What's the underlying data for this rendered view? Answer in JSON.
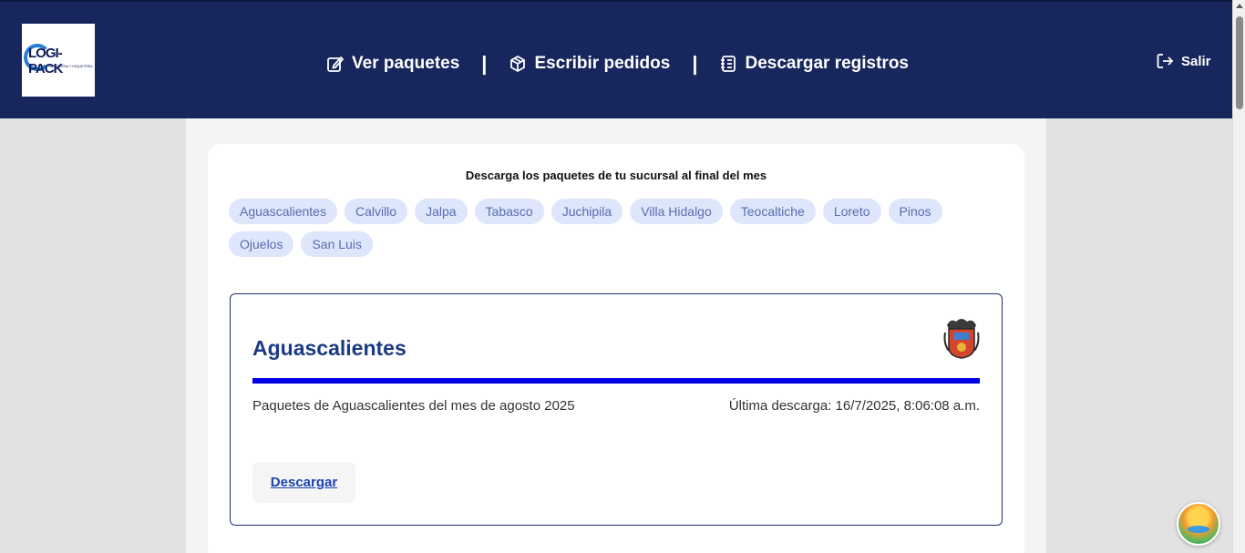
{
  "header": {
    "logo_text": "LOGI-PACK",
    "logo_subtitle": "MENSAJERIA Y PAQUETERIA",
    "nav": [
      {
        "label": "Ver paquetes",
        "icon": "edit-icon"
      },
      {
        "label": "Escribir pedidos",
        "icon": "box-icon"
      },
      {
        "label": "Descargar registros",
        "icon": "notebook-icon"
      }
    ],
    "separator": "|",
    "logout_label": "Salir"
  },
  "main": {
    "title": "Descarga los paquetes de tu sucursal al final del mes",
    "branches": [
      "Aguascalientes",
      "Calvillo",
      "Jalpa",
      "Tabasco",
      "Juchipila",
      "Villa Hidalgo",
      "Teocaltiche",
      "Loreto",
      "Pinos",
      "Ojuelos",
      "San Luis"
    ],
    "selected_branch": {
      "name": "Aguascalientes",
      "description": "Paquetes de Aguascalientes del mes de agosto 2025",
      "last_download": "Última descarga: 16/7/2025, 8:06:08 a.m.",
      "download_label": "Descargar"
    }
  },
  "colors": {
    "header_bg": "#17265c",
    "chip_bg": "#dde6fb",
    "chip_text": "#5a6db0",
    "accent_line": "#0000e6",
    "title_blue": "#1b3a86"
  }
}
